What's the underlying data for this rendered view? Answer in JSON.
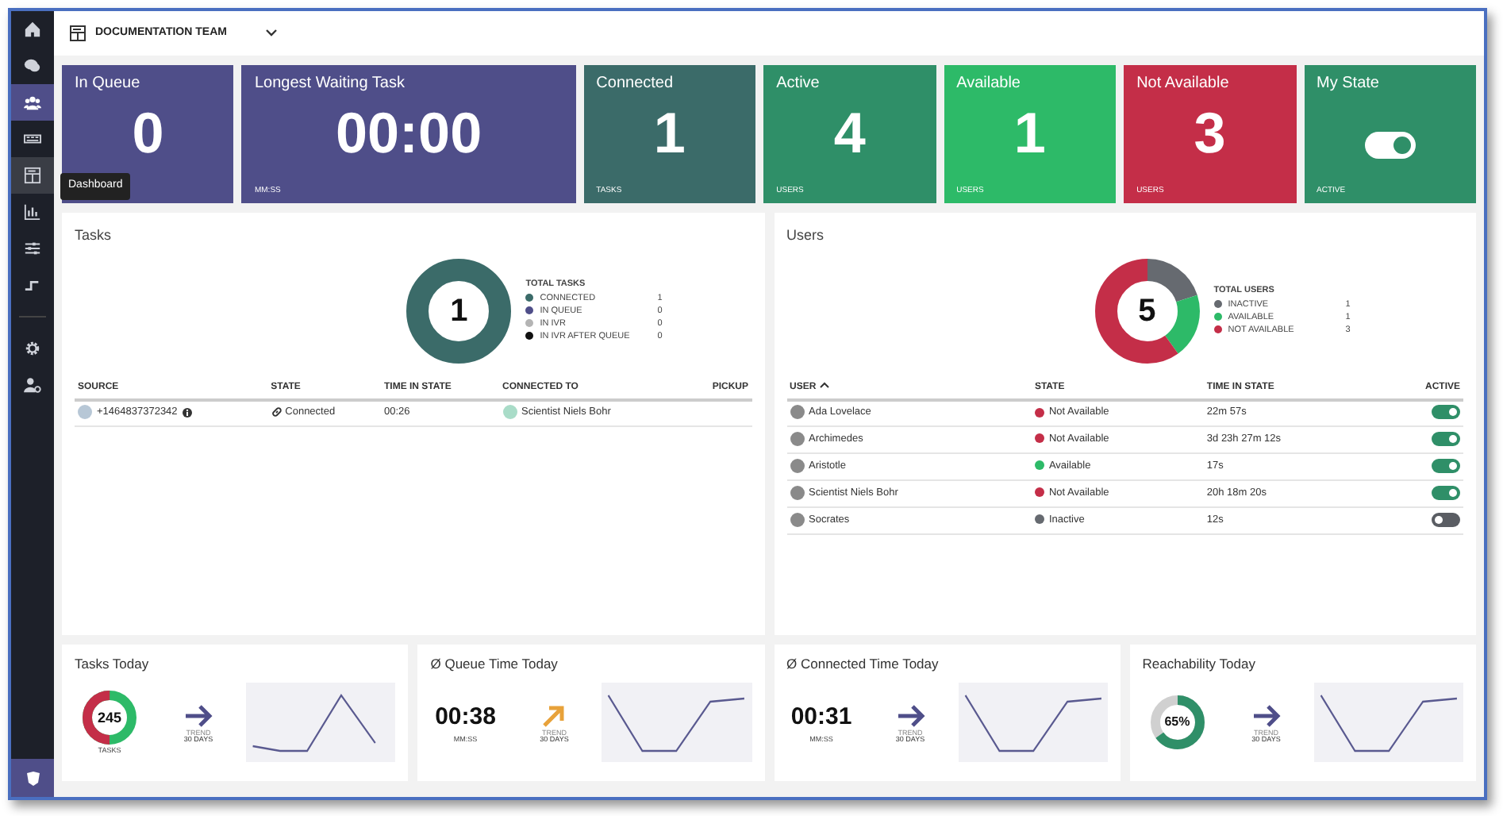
{
  "sidebar": {
    "items": [
      {
        "kind": "home",
        "selected": false
      },
      {
        "kind": "chat",
        "selected": false
      },
      {
        "kind": "users",
        "selected": true
      },
      {
        "kind": "keyboard",
        "selected": false
      },
      {
        "kind": "dashboard",
        "selected": false,
        "hovered": true,
        "tooltip": "Dashboard"
      },
      {
        "kind": "chart",
        "selected": false
      },
      {
        "kind": "sliders",
        "selected": false
      },
      {
        "kind": "steps",
        "selected": false
      },
      {
        "kind": "divider"
      },
      {
        "kind": "gear",
        "selected": false
      },
      {
        "kind": "user-cog",
        "selected": false
      }
    ],
    "bottom": {
      "kind": "logo"
    }
  },
  "header": {
    "team": "DOCUMENTATION TEAM"
  },
  "kpis": [
    {
      "kind": "number",
      "title": "In Queue",
      "value": "0",
      "color": "#4f4e89"
    },
    {
      "kind": "number",
      "title": "Longest Waiting Task",
      "value": "00:00",
      "unit": "MM:SS",
      "color": "#4f4e89"
    },
    {
      "kind": "number",
      "title": "Connected",
      "value": "1",
      "unit": "TASKS",
      "color": "#3b6b69"
    },
    {
      "kind": "number",
      "title": "Active",
      "value": "4",
      "unit": "USERS",
      "color": "#2f8f68"
    },
    {
      "kind": "number",
      "title": "Available",
      "value": "1",
      "unit": "USERS",
      "color": "#2dba68"
    },
    {
      "kind": "number",
      "title": "Not Available",
      "value": "3",
      "unit": "USERS",
      "color": "#c42e48"
    },
    {
      "kind": "toggle",
      "title": "My State",
      "on": true,
      "unit": "ACTIVE",
      "color": "#2f8f68"
    }
  ],
  "tasks": {
    "title": "Tasks",
    "total": "1",
    "legend_title": "TOTAL TASKS",
    "legend": [
      {
        "label": "CONNECTED",
        "count": "1",
        "color": "#3b6b69"
      },
      {
        "label": "IN QUEUE",
        "count": "0",
        "color": "#4f4e89"
      },
      {
        "label": "IN IVR",
        "count": "0",
        "color": "#b4b4b4"
      },
      {
        "label": "IN IVR AFTER QUEUE",
        "count": "0",
        "color": "#111111"
      }
    ],
    "columns": [
      "SOURCE",
      "STATE",
      "TIME IN STATE",
      "CONNECTED TO",
      "PICKUP"
    ],
    "rows": [
      {
        "source": "+1464837372342",
        "state": "Connected",
        "time": "00:26",
        "connected_to": "Scientist Niels Bohr"
      }
    ]
  },
  "users": {
    "title": "Users",
    "total": "5",
    "legend_title": "TOTAL USERS",
    "legend": [
      {
        "label": "INACTIVE",
        "count": "1",
        "color": "#666a70"
      },
      {
        "label": "AVAILABLE",
        "count": "1",
        "color": "#2dba68"
      },
      {
        "label": "NOT AVAILABLE",
        "count": "3",
        "color": "#c42e48"
      }
    ],
    "columns": [
      {
        "label": "USER",
        "sorted": true
      },
      {
        "label": "STATE"
      },
      {
        "label": "TIME IN STATE"
      },
      {
        "label": "ACTIVE"
      }
    ],
    "rows": [
      {
        "name": "Ada Lovelace",
        "state": "Not Available",
        "color": "#c42e48",
        "time": "22m 57s",
        "active": true
      },
      {
        "name": "Archimedes",
        "state": "Not Available",
        "color": "#c42e48",
        "time": "3d 23h 27m 12s",
        "active": true
      },
      {
        "name": "Aristotle",
        "state": "Available",
        "color": "#2dba68",
        "time": "17s",
        "active": true
      },
      {
        "name": "Scientist Niels Bohr",
        "state": "Not Available",
        "color": "#c42e48",
        "time": "20h 18m 20s",
        "active": true
      },
      {
        "name": "Socrates",
        "state": "Inactive",
        "color": "#666a70",
        "time": "12s",
        "active": false
      }
    ]
  },
  "today": [
    {
      "kind": "ring",
      "title": "Tasks Today",
      "value": "245",
      "caption": "TASKS",
      "trend": {
        "kind": "flat",
        "label": "TREND",
        "period": "30 DAYS"
      }
    },
    {
      "kind": "time",
      "title": "Ø Queue Time Today",
      "value": "00:38",
      "caption": "MM:SS",
      "trend": {
        "kind": "up",
        "label": "TREND",
        "period": "30 DAYS"
      }
    },
    {
      "kind": "time",
      "title": "Ø Connected Time Today",
      "value": "00:31",
      "caption": "MM:SS",
      "trend": {
        "kind": "flat",
        "label": "TREND",
        "period": "30 DAYS"
      }
    },
    {
      "kind": "meter",
      "title": "Reachability Today",
      "value": "65%",
      "level": 0.65,
      "trend": {
        "kind": "flat",
        "label": "TREND",
        "period": "30 DAYS"
      }
    }
  ]
}
